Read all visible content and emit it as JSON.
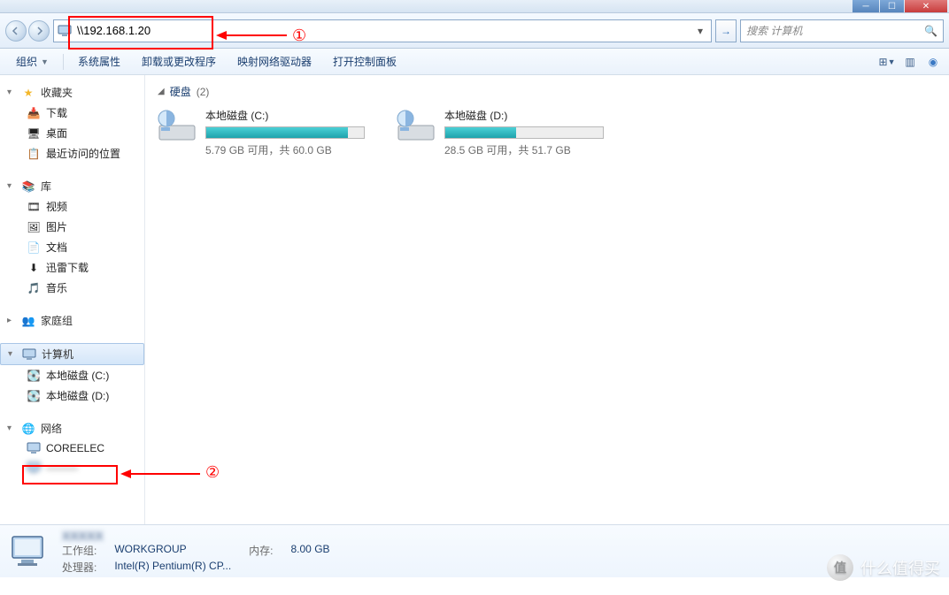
{
  "address_bar": {
    "value": "\\\\192.168.1.20",
    "go_tooltip": "转到"
  },
  "search": {
    "placeholder": "搜索 计算机"
  },
  "toolbar": {
    "organize": "组织",
    "system_props": "系统属性",
    "uninstall": "卸载或更改程序",
    "map_drive": "映射网络驱动器",
    "control_panel": "打开控制面板"
  },
  "sidebar": {
    "favorites": {
      "label": "收藏夹",
      "items": [
        "下载",
        "桌面",
        "最近访问的位置"
      ]
    },
    "libraries": {
      "label": "库",
      "items": [
        "视频",
        "图片",
        "文档",
        "迅雷下载",
        "音乐"
      ]
    },
    "homegroup": {
      "label": "家庭组"
    },
    "computer_group": {
      "label": "计算机",
      "items": [
        "本地磁盘 (C:)",
        "本地磁盘 (D:)"
      ]
    },
    "network": {
      "label": "网络",
      "items": [
        "COREELEC",
        "———"
      ]
    }
  },
  "content": {
    "section": {
      "title": "硬盘",
      "count": "(2)"
    },
    "drives": [
      {
        "name": "本地磁盘 (C:)",
        "fill_pct": 90,
        "info": "5.79 GB 可用，共 60.0 GB"
      },
      {
        "name": "本地磁盘 (D:)",
        "fill_pct": 45,
        "info": "28.5 GB 可用，共 51.7 GB"
      }
    ]
  },
  "status": {
    "name_blur": "XXXXX",
    "workgroup_label": "工作组:",
    "workgroup_val": "WORKGROUP",
    "memory_label": "内存:",
    "memory_val": "8.00 GB",
    "cpu_label": "处理器:",
    "cpu_val": "Intel(R) Pentium(R) CP..."
  },
  "annotations": {
    "num1": "①",
    "num2": "②"
  },
  "watermark": "什么值得买"
}
